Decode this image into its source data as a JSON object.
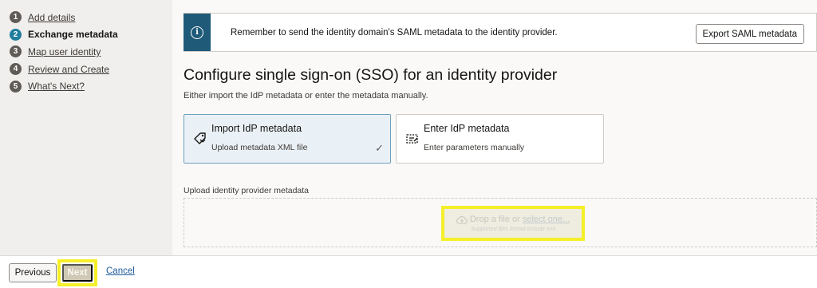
{
  "steps": [
    {
      "num": "1",
      "label": "Add details"
    },
    {
      "num": "2",
      "label": "Exchange metadata"
    },
    {
      "num": "3",
      "label": "Map user identity"
    },
    {
      "num": "4",
      "label": "Review and Create"
    },
    {
      "num": "5",
      "label": "What's Next?"
    }
  ],
  "banner": {
    "icon": "info-icon",
    "icon_glyph": "i",
    "message": "Remember to send the identity domain's SAML metadata to the identity provider.",
    "export_label": "Export SAML metadata"
  },
  "page": {
    "heading": "Configure single sign-on (SSO) for an identity provider",
    "subheading": "Either import the IdP metadata or enter the metadata manually."
  },
  "options": {
    "import": {
      "title": "Import IdP metadata",
      "desc": "Upload metadata XML file",
      "check": "✓"
    },
    "enter": {
      "title": "Enter IdP metadata",
      "desc": "Enter parameters manually"
    }
  },
  "upload": {
    "label": "Upload identity provider metadata",
    "drop_text": "Drop a file or",
    "select_link": "select one...",
    "hint": "Supported files format include xml"
  },
  "footer": {
    "previous": "Previous",
    "next": "Next",
    "cancel": "Cancel"
  },
  "colors": {
    "accent": "#227e9e",
    "banner_bar": "#1f5a78",
    "highlight": "#f5ef29",
    "link": "#1f5a9e"
  }
}
